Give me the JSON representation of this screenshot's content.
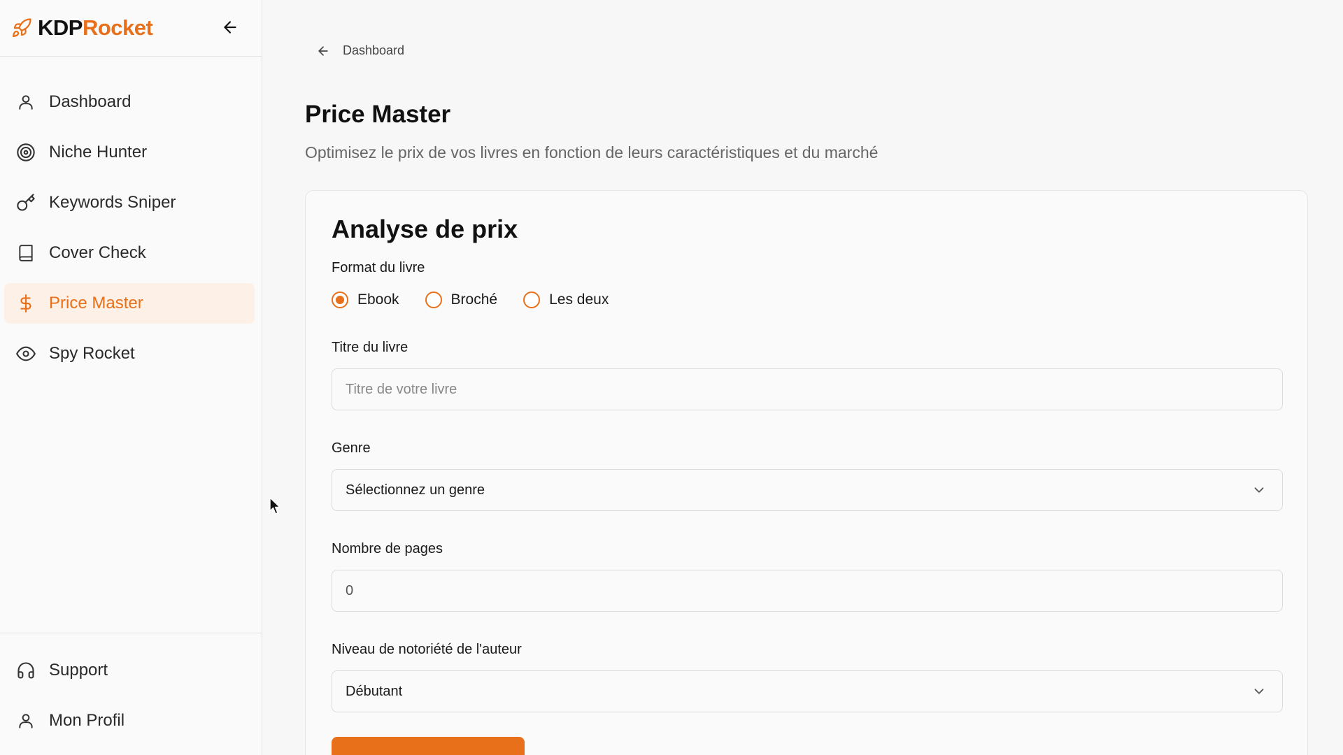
{
  "brand": {
    "part1": "KDP",
    "part2": "Rocket",
    "accent": "#e8701a"
  },
  "sidebar": {
    "items": [
      {
        "label": "Dashboard",
        "icon": "user-icon"
      },
      {
        "label": "Niche Hunter",
        "icon": "target-icon"
      },
      {
        "label": "Keywords Sniper",
        "icon": "key-icon"
      },
      {
        "label": "Cover Check",
        "icon": "book-icon"
      },
      {
        "label": "Price Master",
        "icon": "dollar-icon",
        "active": true
      },
      {
        "label": "Spy Rocket",
        "icon": "eye-icon"
      }
    ],
    "bottom": [
      {
        "label": "Support",
        "icon": "headphones-icon"
      },
      {
        "label": "Mon Profil",
        "icon": "user-icon"
      }
    ]
  },
  "breadcrumb": {
    "label": "Dashboard"
  },
  "page": {
    "title": "Price Master",
    "subtitle": "Optimisez le prix de vos livres en fonction de leurs caractéristiques et du marché"
  },
  "form": {
    "title": "Analyse de prix",
    "format_label": "Format du livre",
    "format_options": [
      "Ebook",
      "Broché",
      "Les deux"
    ],
    "format_selected": "Ebook",
    "title_label": "Titre du livre",
    "title_placeholder": "Titre de votre livre",
    "genre_label": "Genre",
    "genre_value": "Sélectionnez un genre",
    "pages_label": "Nombre de pages",
    "pages_value": "0",
    "notoriety_label": "Niveau de notoriété de l'auteur",
    "notoriety_value": "Débutant",
    "submit_label": ""
  }
}
